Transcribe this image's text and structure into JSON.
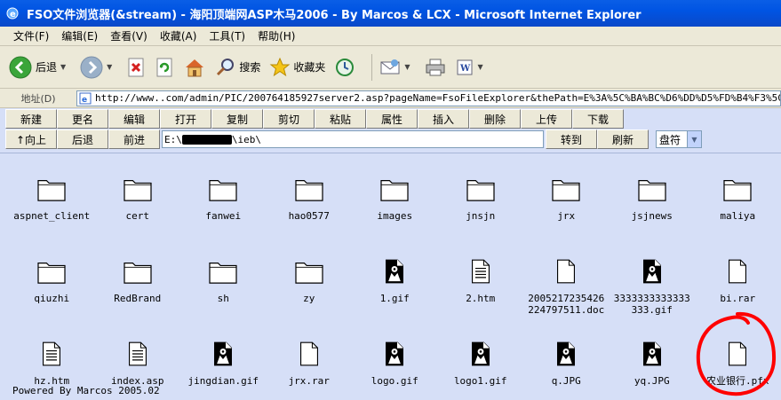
{
  "window": {
    "title": "FSO文件浏览器(&stream) - 海阳顶端网ASP木马2006 - By Marcos & LCX - Microsoft Internet Explorer"
  },
  "menu": [
    "文件(F)",
    "编辑(E)",
    "查看(V)",
    "收藏(A)",
    "工具(T)",
    "帮助(H)"
  ],
  "toolbar": {
    "back_label": "后退",
    "search_label": "搜索",
    "favorites_label": "收藏夹"
  },
  "address": {
    "label": "地址(D)",
    "url_prefix": "http://www.",
    "url_suffix": ".com/admin/PIC/200764185927server2.asp?pageName=FsoFileExplorer&thePath=E%3A%5C%BA%BC%D6%DD%D5%FD%B4%F3%5Cieb%5"
  },
  "commands": [
    "新建",
    "更名",
    "编辑",
    "打开",
    "复制",
    "剪切",
    "粘贴",
    "属性",
    "插入",
    "删除",
    "上传",
    "下载"
  ],
  "nav": {
    "up_label": "↑向上",
    "back_label": "后退",
    "forward_label": "前进",
    "path_prefix": "E:\\",
    "path_suffix": "\\ieb\\",
    "goto_label": "转到",
    "refresh_label": "刷新",
    "drive_select": "盘符"
  },
  "files": [
    {
      "name": "aspnet_client",
      "type": "folder"
    },
    {
      "name": "cert",
      "type": "folder"
    },
    {
      "name": "fanwei",
      "type": "folder"
    },
    {
      "name": "hao0577",
      "type": "folder"
    },
    {
      "name": "images",
      "type": "folder"
    },
    {
      "name": "jnsjn",
      "type": "folder"
    },
    {
      "name": "jrx",
      "type": "folder"
    },
    {
      "name": "jsjnews",
      "type": "folder"
    },
    {
      "name": "maliya",
      "type": "folder"
    },
    {
      "name": "qiuzhi",
      "type": "folder"
    },
    {
      "name": "RedBrand",
      "type": "folder"
    },
    {
      "name": "sh",
      "type": "folder"
    },
    {
      "name": "zy",
      "type": "folder"
    },
    {
      "name": "1.gif",
      "type": "image"
    },
    {
      "name": "2.htm",
      "type": "text"
    },
    {
      "name": "2005217235426224797511.doc",
      "type": "file"
    },
    {
      "name": "3333333333333333.gif",
      "type": "image"
    },
    {
      "name": "bi.rar",
      "type": "file"
    },
    {
      "name": "hz.htm",
      "type": "text"
    },
    {
      "name": "index.asp",
      "type": "text"
    },
    {
      "name": "jingdian.gif",
      "type": "image"
    },
    {
      "name": "jrx.rar",
      "type": "file"
    },
    {
      "name": "logo.gif",
      "type": "image"
    },
    {
      "name": "logo1.gif",
      "type": "image"
    },
    {
      "name": "q.JPG",
      "type": "image"
    },
    {
      "name": "yq.JPG",
      "type": "image"
    },
    {
      "name": "农业银行.pfx",
      "type": "file"
    }
  ],
  "footer": "Powered By Marcos 2005.02",
  "colors": {
    "content_bg": "#d6dff7",
    "titlebar": "#0054e3",
    "annotation": "#ff0000"
  }
}
